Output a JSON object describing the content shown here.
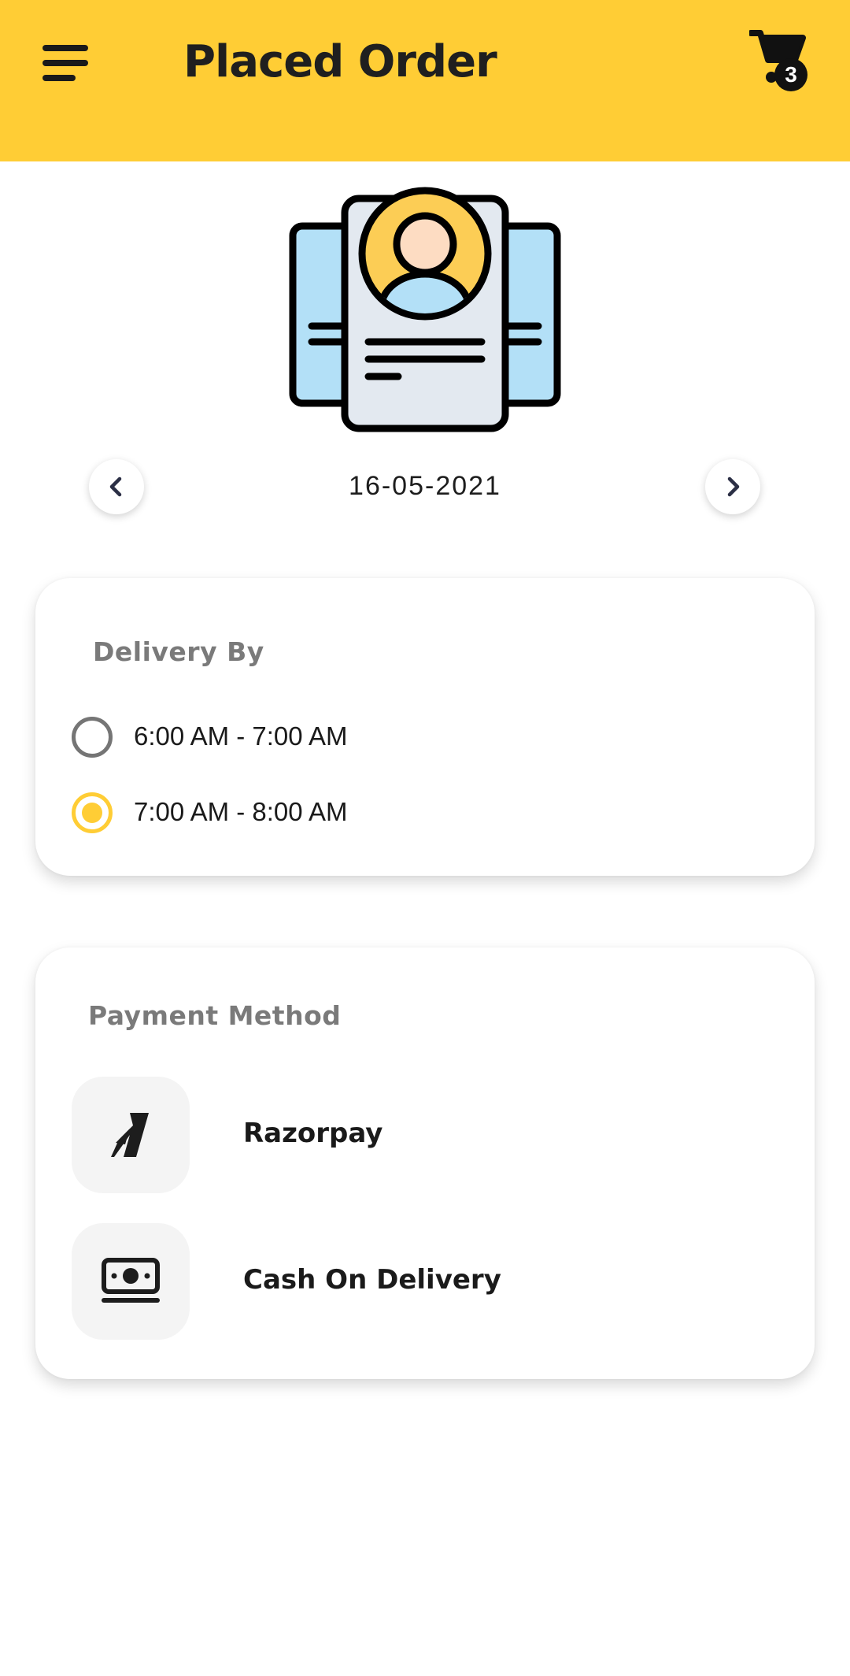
{
  "header": {
    "title": "Placed Order",
    "cart_count": "3",
    "background_color": "#ffcd35"
  },
  "icons": {
    "menu": "menu-icon",
    "cart": "cart-icon",
    "illustration": "profile-document-icon",
    "prev": "chevron-left-icon",
    "next": "chevron-right-icon",
    "razorpay": "razorpay-logo-icon",
    "cash": "cash-icon"
  },
  "date_selector": {
    "date": "16-05-2021"
  },
  "delivery": {
    "title": "Delivery By",
    "options": [
      {
        "label": "6:00 AM - 7:00 AM",
        "selected": false
      },
      {
        "label": "7:00 AM - 8:00 AM",
        "selected": true
      }
    ],
    "accent_color": "#ffcd35"
  },
  "payment": {
    "title": "Payment Method",
    "methods": [
      {
        "label": "Razorpay"
      },
      {
        "label": "Cash On Delivery"
      }
    ]
  }
}
